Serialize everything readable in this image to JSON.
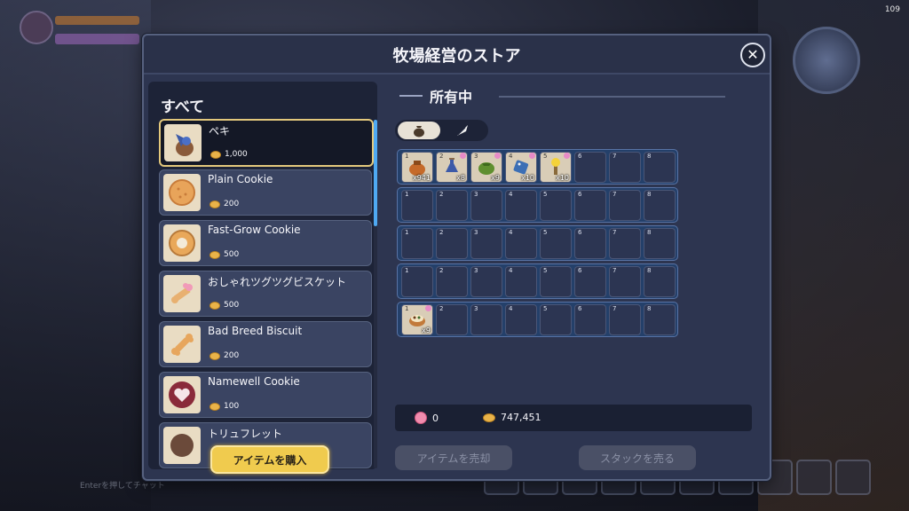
{
  "hud": {
    "fps": "109",
    "chat_hint": "Enterを押してチャット"
  },
  "store": {
    "title": "牧場経営のストア"
  },
  "category": {
    "title": "すべて"
  },
  "items": [
    {
      "name": "ペキ",
      "price": "1,000",
      "selected": true,
      "icon": "blue-bird-icon"
    },
    {
      "name": "Plain Cookie",
      "price": "200",
      "icon": "plain-cookie-icon"
    },
    {
      "name": "Fast-Grow Cookie",
      "price": "500",
      "icon": "ring-cookie-icon"
    },
    {
      "name": "おしゃれツグツグビスケット",
      "price": "500",
      "icon": "pink-bone-biscuit-icon"
    },
    {
      "name": "Bad Breed Biscuit",
      "price": "200",
      "icon": "bone-biscuit-icon"
    },
    {
      "name": "Namewell Cookie",
      "price": "100",
      "icon": "heart-cookie-icon"
    },
    {
      "name": "トリュフレット",
      "price": "",
      "icon": "truffle-icon"
    }
  ],
  "owned": {
    "title": "所有中",
    "tabs": [
      {
        "icon": "bag-icon",
        "active": true
      },
      {
        "icon": "feather-icon",
        "active": false
      }
    ],
    "rows": [
      [
        {
          "num": "1",
          "qty": "x941",
          "icon": "orange-bag-icon"
        },
        {
          "num": "2",
          "qty": "x8",
          "icon": "blue-bottle-icon",
          "pin": true
        },
        {
          "num": "3",
          "qty": "x9",
          "icon": "green-pouch-icon",
          "pin": true
        },
        {
          "num": "4",
          "qty": "x10",
          "icon": "blue-tag-icon",
          "pin": true
        },
        {
          "num": "5",
          "qty": "x10",
          "icon": "yellow-torch-icon",
          "pin": true
        },
        {
          "num": "6"
        },
        {
          "num": "7"
        },
        {
          "num": "8"
        }
      ],
      [
        {
          "num": "1"
        },
        {
          "num": "2"
        },
        {
          "num": "3"
        },
        {
          "num": "4"
        },
        {
          "num": "5"
        },
        {
          "num": "6"
        },
        {
          "num": "7"
        },
        {
          "num": "8"
        }
      ],
      [
        {
          "num": "1"
        },
        {
          "num": "2"
        },
        {
          "num": "3"
        },
        {
          "num": "4"
        },
        {
          "num": "5"
        },
        {
          "num": "6"
        },
        {
          "num": "7"
        },
        {
          "num": "8"
        }
      ],
      [
        {
          "num": "1"
        },
        {
          "num": "2"
        },
        {
          "num": "3"
        },
        {
          "num": "4"
        },
        {
          "num": "5"
        },
        {
          "num": "6"
        },
        {
          "num": "7"
        },
        {
          "num": "8"
        }
      ],
      [
        {
          "num": "1",
          "qty": "x9",
          "icon": "food-bowl-icon",
          "pin": true
        },
        {
          "num": "2"
        },
        {
          "num": "3"
        },
        {
          "num": "4"
        },
        {
          "num": "5"
        },
        {
          "num": "6"
        },
        {
          "num": "7"
        },
        {
          "num": "8"
        }
      ]
    ]
  },
  "currency": {
    "gems": "0",
    "coins": "747,451"
  },
  "buttons": {
    "buy": "アイテムを購入",
    "sell": "アイテムを売却",
    "sell_stack": "スタックを売る"
  },
  "colors": {
    "accent_gold": "#f0cb4e",
    "selection_border": "#e3c87c",
    "scroll_thumb": "#4fa9f2"
  }
}
